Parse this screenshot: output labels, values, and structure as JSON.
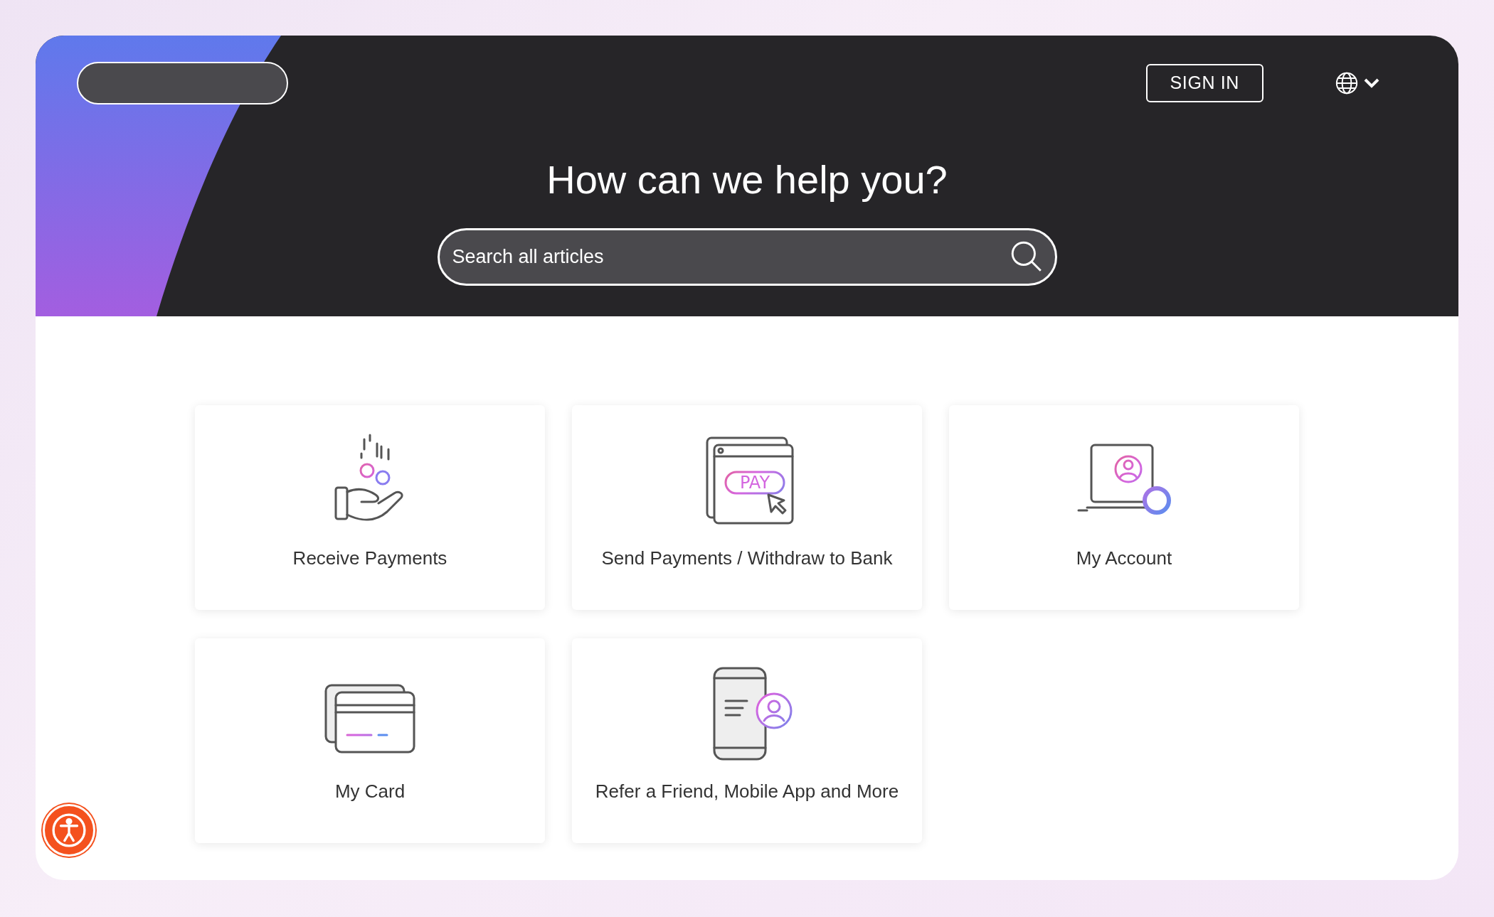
{
  "header": {
    "sign_in": "SIGN IN",
    "title": "How can we help you?",
    "search": {
      "placeholder": "Search all articles"
    }
  },
  "categories": [
    {
      "label": "Receive Payments"
    },
    {
      "label": "Send Payments / Withdraw to Bank",
      "icon_text": "PAY"
    },
    {
      "label": "My Account"
    },
    {
      "label": "My Card"
    },
    {
      "label": "Refer a Friend, Mobile App and More"
    }
  ]
}
